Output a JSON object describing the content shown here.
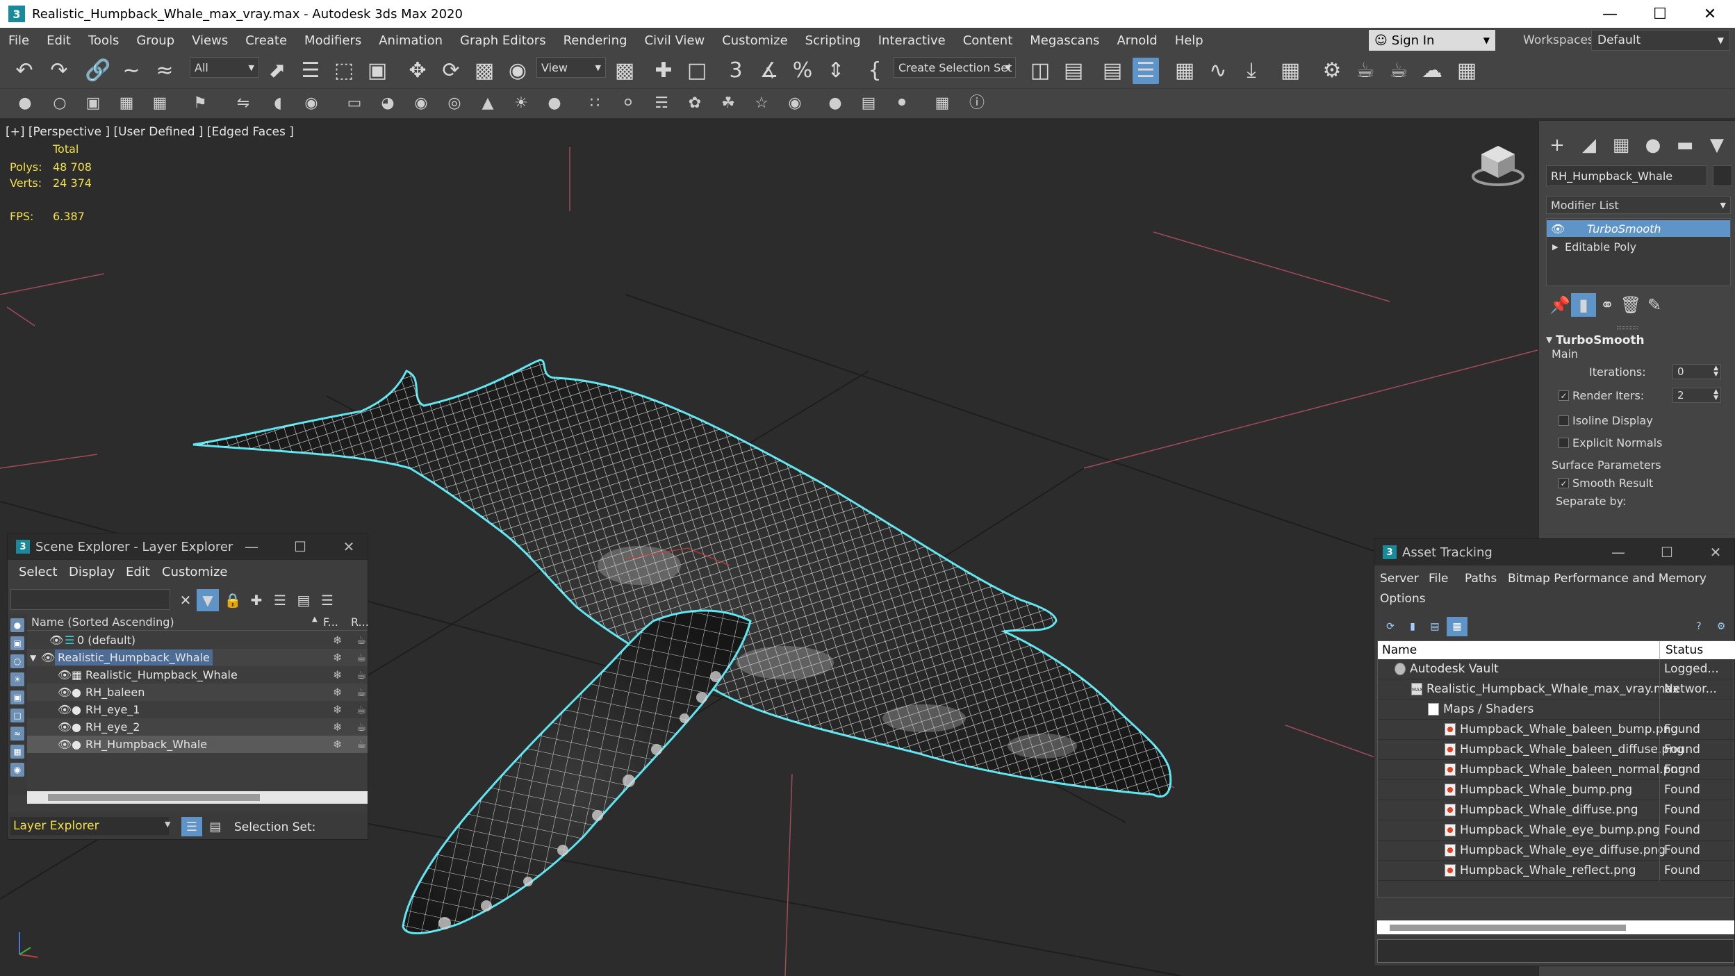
{
  "window": {
    "title": "Realistic_Humpback_Whale_max_vray.max - Autodesk 3ds Max 2020",
    "app_icon": "3",
    "minimize": "—",
    "maximize": "☐",
    "close": "✕"
  },
  "menu": [
    "File",
    "Edit",
    "Tools",
    "Group",
    "Views",
    "Create",
    "Modifiers",
    "Animation",
    "Graph Editors",
    "Rendering",
    "Civil View",
    "Customize",
    "Scripting",
    "Interactive",
    "Content",
    "Megascans",
    "Arnold",
    "Help"
  ],
  "account": {
    "sign_in": "Sign In",
    "workspaces_label": "Workspaces:",
    "workspace": "Default"
  },
  "toolbar": {
    "filter": "All",
    "ref_coord": "View",
    "selection_set": "Create Selection Set"
  },
  "viewport": {
    "label": "[+] [Perspective ] [User Defined ] [Edged Faces ]",
    "stats": {
      "total_label": "Total",
      "polys_label": "Polys:",
      "polys": "48 708",
      "verts_label": "Verts:",
      "verts": "24 374",
      "fps_label": "FPS:",
      "fps": "6.387"
    }
  },
  "command_panel": {
    "object_name": "RH_Humpback_Whale",
    "modifier_list": "Modifier List",
    "stack": [
      "TurboSmooth",
      "Editable Poly"
    ],
    "rollout": {
      "title": "TurboSmooth",
      "main": "Main",
      "iterations_label": "Iterations:",
      "iterations": "0",
      "render_iters_label": "Render Iters:",
      "render_iters": "2",
      "isoline_display": "Isoline Display",
      "explicit_normals": "Explicit Normals",
      "surface_parameters": "Surface Parameters",
      "smooth_result": "Smooth Result",
      "separate_by": "Separate by:"
    }
  },
  "scene_explorer": {
    "title": "Scene Explorer - Layer Explorer",
    "menu": [
      "Select",
      "Display",
      "Edit",
      "Customize"
    ],
    "column_name": "Name (Sorted Ascending)",
    "column_f": "F...",
    "column_r": "R...",
    "rows": [
      {
        "name": "0 (default)"
      },
      {
        "name": "Realistic_Humpback_Whale"
      },
      {
        "name": "Realistic_Humpback_Whale"
      },
      {
        "name": "RH_baleen"
      },
      {
        "name": "RH_eye_1"
      },
      {
        "name": "RH_eye_2"
      },
      {
        "name": "RH_Humpback_Whale"
      }
    ],
    "footer_explorer": "Layer Explorer",
    "selection_set": "Selection Set:"
  },
  "asset_tracking": {
    "title": "Asset Tracking",
    "menu": [
      "Server",
      "File",
      "Paths",
      "Bitmap Performance and Memory",
      "Options"
    ],
    "col_name": "Name",
    "col_status": "Status",
    "rows": [
      {
        "name": "Autodesk Vault",
        "status": "Logged..."
      },
      {
        "name": "Realistic_Humpback_Whale_max_vray.max",
        "status": "Networ..."
      },
      {
        "name": "Maps / Shaders",
        "status": ""
      },
      {
        "name": "Humpback_Whale_baleen_bump.png",
        "status": "Found"
      },
      {
        "name": "Humpback_Whale_baleen_diffuse.png",
        "status": "Found"
      },
      {
        "name": "Humpback_Whale_baleen_normal.png",
        "status": "Found"
      },
      {
        "name": "Humpback_Whale_bump.png",
        "status": "Found"
      },
      {
        "name": "Humpback_Whale_diffuse.png",
        "status": "Found"
      },
      {
        "name": "Humpback_Whale_eye_bump.png",
        "status": "Found"
      },
      {
        "name": "Humpback_Whale_eye_diffuse.png",
        "status": "Found"
      },
      {
        "name": "Humpback_Whale_reflect.png",
        "status": "Found"
      }
    ]
  },
  "colors": {
    "accent": "#5f94c9",
    "stats_text": "#f2e14a",
    "selection_outline": "#5ee6f0"
  },
  "icons": [
    "undo-icon",
    "redo-icon",
    "link-icon",
    "unlink-icon",
    "select-icon",
    "move-icon",
    "rotate-icon",
    "scale-icon",
    "snap-icon",
    "angle-snap-icon",
    "percent-snap-icon",
    "mirror-icon",
    "align-icon",
    "layer-icon",
    "curve-editor-icon",
    "render-setup-icon",
    "render-icon",
    "pin-icon",
    "trash-icon",
    "eye-icon",
    "lock-icon",
    "filter-icon"
  ]
}
